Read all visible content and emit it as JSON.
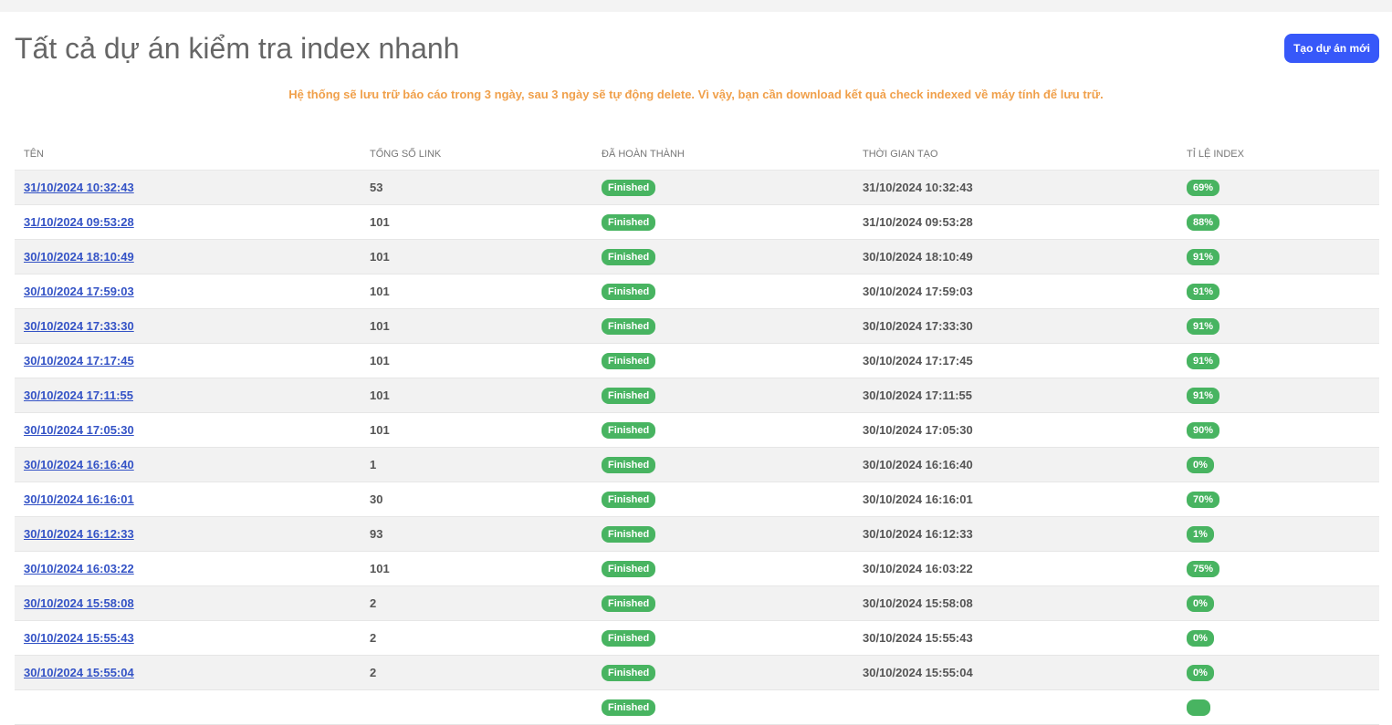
{
  "page": {
    "title": "Tất cả dự án kiểm tra index nhanh",
    "new_project_label": "Tạo dự án mới",
    "notice": "Hệ thống sẽ lưu trữ báo cáo trong 3 ngày, sau 3 ngày sẽ tự động delete. Vì vậy, bạn cần download kết quả check indexed về máy tính để lưu trữ."
  },
  "colors": {
    "primary_button": "#3758f9",
    "notice_text": "#f0a04b",
    "badge_green": "#48b461",
    "link": "#3453c6"
  },
  "table": {
    "headers": [
      "Tên",
      "Tổng số link",
      "Đã hoàn thành",
      "Thời gian tạo",
      "Tỉ lệ index"
    ],
    "rows": [
      {
        "name": "31/10/2024 10:32:43",
        "total": "53",
        "status": "Finished",
        "created": "31/10/2024 10:32:43",
        "rate": "69%"
      },
      {
        "name": "31/10/2024 09:53:28",
        "total": "101",
        "status": "Finished",
        "created": "31/10/2024 09:53:28",
        "rate": "88%"
      },
      {
        "name": "30/10/2024 18:10:49",
        "total": "101",
        "status": "Finished",
        "created": "30/10/2024 18:10:49",
        "rate": "91%"
      },
      {
        "name": "30/10/2024 17:59:03",
        "total": "101",
        "status": "Finished",
        "created": "30/10/2024 17:59:03",
        "rate": "91%"
      },
      {
        "name": "30/10/2024 17:33:30",
        "total": "101",
        "status": "Finished",
        "created": "30/10/2024 17:33:30",
        "rate": "91%"
      },
      {
        "name": "30/10/2024 17:17:45",
        "total": "101",
        "status": "Finished",
        "created": "30/10/2024 17:17:45",
        "rate": "91%"
      },
      {
        "name": "30/10/2024 17:11:55",
        "total": "101",
        "status": "Finished",
        "created": "30/10/2024 17:11:55",
        "rate": "91%"
      },
      {
        "name": "30/10/2024 17:05:30",
        "total": "101",
        "status": "Finished",
        "created": "30/10/2024 17:05:30",
        "rate": "90%"
      },
      {
        "name": "30/10/2024 16:16:40",
        "total": "1",
        "status": "Finished",
        "created": "30/10/2024 16:16:40",
        "rate": "0%"
      },
      {
        "name": "30/10/2024 16:16:01",
        "total": "30",
        "status": "Finished",
        "created": "30/10/2024 16:16:01",
        "rate": "70%"
      },
      {
        "name": "30/10/2024 16:12:33",
        "total": "93",
        "status": "Finished",
        "created": "30/10/2024 16:12:33",
        "rate": "1%"
      },
      {
        "name": "30/10/2024 16:03:22",
        "total": "101",
        "status": "Finished",
        "created": "30/10/2024 16:03:22",
        "rate": "75%"
      },
      {
        "name": "30/10/2024 15:58:08",
        "total": "2",
        "status": "Finished",
        "created": "30/10/2024 15:58:08",
        "rate": "0%"
      },
      {
        "name": "30/10/2024 15:55:43",
        "total": "2",
        "status": "Finished",
        "created": "30/10/2024 15:55:43",
        "rate": "0%"
      },
      {
        "name": "30/10/2024 15:55:04",
        "total": "2",
        "status": "Finished",
        "created": "30/10/2024 15:55:04",
        "rate": "0%"
      },
      {
        "name": "",
        "total": "",
        "status": "Finished",
        "created": "",
        "rate": ""
      }
    ]
  }
}
